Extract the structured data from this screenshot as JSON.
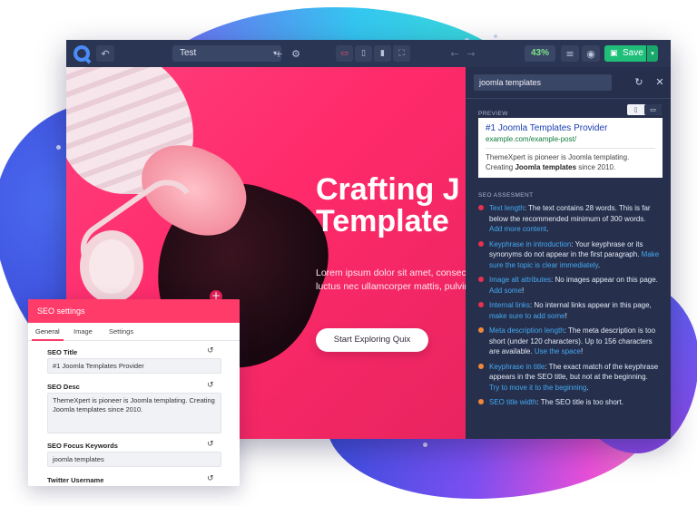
{
  "editor": {
    "page_name": "Test",
    "zoom": "43%",
    "save_label": "Save",
    "icons": [
      "quix-logo-icon",
      "undo-icon",
      "add-icon",
      "settings-icon",
      "desktop-icon",
      "tablet-icon",
      "mobile-icon",
      "fullscreen-icon",
      "back-icon",
      "forward-icon",
      "database-icon",
      "eye-icon",
      "save-icon",
      "chevron-down-icon"
    ]
  },
  "hero": {
    "title_line1": "Crafting J",
    "title_line2": "Template",
    "text_line1": "Lorem ipsum dolor sit amet, consect",
    "text_line2": "luctus nec ullamcorper mattis, pulvin",
    "button_label": "Start Exploring Quix"
  },
  "seo_panel": {
    "keyword": "joomla templates",
    "preview_label": "PREVIEW",
    "preview": {
      "title": "#1 Joomla Templates Provider",
      "url": "example.com/example-post/",
      "desc_prefix": "ThemeXpert is pioneer is Joomla templating. Creating ",
      "desc_bold": "Joomla templates",
      "desc_suffix": " since 2010."
    },
    "assessment_label": "SEO ASSESMENT",
    "assessments": [
      {
        "status_color": "#e8304f",
        "title": "Text length",
        "text": ": The text contains 28 words. This is far below the recommended minimum of 300 words. ",
        "link": "Add more content",
        "after": "."
      },
      {
        "status_color": "#e8304f",
        "title": "Keyphrase in introduction",
        "text": ": Your keyphrase or its synonyms do not appear in the first paragraph. ",
        "link": "Make sure the topic is clear immediately",
        "after": "."
      },
      {
        "status_color": "#e8304f",
        "title": "Image alt attributes",
        "text": ": No images appear on this page. ",
        "link": "Add some",
        "after": "!"
      },
      {
        "status_color": "#e8304f",
        "title": "Internal links",
        "text": ": No internal links appear in this page, ",
        "link": "make sure to add some",
        "after": "!"
      },
      {
        "status_color": "#f0883a",
        "title": "Meta description length",
        "text": ": The meta description is too short (under 120 characters). Up to 156 characters are available. ",
        "link": "Use the space",
        "after": "!"
      },
      {
        "status_color": "#f0883a",
        "title": "Keyphrase in title",
        "text": ": The exact match of the keyphrase appears in the SEO title, but not at the beginning. ",
        "link": "Try to move it to the beginning",
        "after": "."
      },
      {
        "status_color": "#f0883a",
        "title": "SEO title width",
        "text": ": The SEO title is too short.",
        "link": "",
        "after": ""
      }
    ]
  },
  "seo_settings": {
    "title": "SEO settings",
    "tabs": [
      "General",
      "Image",
      "Settings"
    ],
    "fields": {
      "seo_title_label": "SEO Title",
      "seo_title_value": "#1 Joomla Templates Provider",
      "seo_desc_label": "SEO Desc",
      "seo_desc_value": "ThemeXpert is pioneer is Joomla templating. Creating Joomla templates since 2010.",
      "focus_label": "SEO Focus Keywords",
      "focus_value": "joomla templates",
      "twitter_label": "Twitter Username"
    }
  }
}
